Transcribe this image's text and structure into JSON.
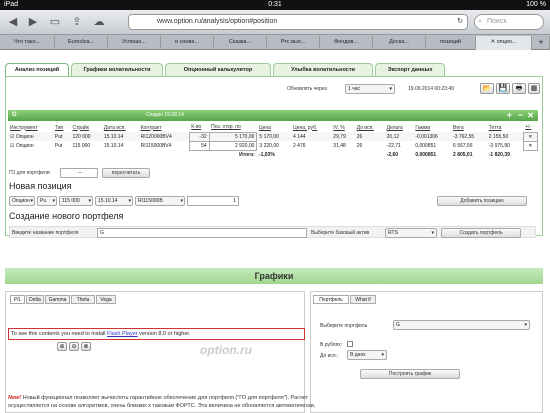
{
  "status": {
    "carrier": "iPad",
    "time": "0:31",
    "battery": "100 %"
  },
  "browser": {
    "url": "www.option.ru/analysis/option#position",
    "search_placeholder": "Поиск",
    "tabs": [
      "Что тако...",
      "Euroclea...",
      "Успешн...",
      "и снова...",
      "Сказка...",
      "Ртс вых...",
      "Фондов...",
      "Доска...",
      "позиций",
      "опцио..."
    ]
  },
  "app_tabs": [
    "Анализ позиций",
    "Графики волатильности",
    "Опционный калькулятор",
    "Улыбка волатильности",
    "Экспорт данных"
  ],
  "refresh": {
    "label": "Обновлять через",
    "value": "1 час",
    "timestamp": "19.09.2014 00:23:49"
  },
  "portfolio_header": {
    "name": "G",
    "created": "Создан 19.09.14"
  },
  "table": {
    "headers": [
      "Инструмент",
      "Тип",
      "Страйк",
      "Дата исп.",
      "Контракт",
      "К-во",
      "Поз. откр. по",
      "Цена",
      "Цена, руб.",
      "IV, %",
      "До исп.",
      "Дельта",
      "Гамма",
      "Вега",
      "Тетта",
      "+/-"
    ],
    "rows": [
      [
        "Опцион",
        "Put",
        "120 000",
        "15.10.14",
        "RI120000BV4",
        "-32",
        "5 170,00",
        "5 170,00",
        "4 144",
        "29,79",
        "26",
        "20,12",
        "-0,001306",
        "-3 762,55",
        "2 155,50"
      ],
      [
        "Опцион",
        "Put",
        "115 000",
        "15.10.14",
        "RI115000BV4",
        "54",
        "2 920,00",
        "3 220,00",
        "2 476",
        "31,48",
        "26",
        "-22,71",
        "0,000851",
        "6 567,56",
        "-3 975,90"
      ]
    ],
    "total_label": "Итого:",
    "total_pct": "-1,03%",
    "totals": [
      "-2,60",
      "0,000851",
      "2 805,01",
      "-1 820,39"
    ]
  },
  "go": {
    "label": "ГО для портфеля:",
    "value": "--",
    "button": "пересчитать"
  },
  "new_position": {
    "title": "Новая позиция",
    "type": "Опцион",
    "kind": "Pu",
    "strike": "115 000",
    "date": "15.10.14",
    "contract": "RI115000B",
    "qty": "1",
    "button": "Добавить позицию"
  },
  "new_portfolio": {
    "title": "Создание нового портфеля",
    "name_label": "Введите название портфеля",
    "name_value": "G",
    "asset_label": "Выберите базовый актив",
    "asset_value": "RTS",
    "button": "Создать портфель"
  },
  "charts": {
    "title": "Графики",
    "tabs": [
      "P/L",
      "Delta",
      "Gamma",
      "Theta",
      "Vega"
    ],
    "flash_msg": "To see this contents you need to install ",
    "flash_link": "Flash Player",
    "flash_msg2": " version 8.0 or higher.",
    "watermark": "option.ru"
  },
  "side": {
    "tabs": [
      "Портфель",
      "What if"
    ],
    "portfolio_label": "Выберите портфель",
    "portfolio_value": "G",
    "rub_label": "В рублях:",
    "until_label": "До исп.:",
    "until_value": "В днях",
    "button": "Построить график"
  },
  "footer": {
    "badge": "New!",
    "text1": "Новый функционал позволяет вычислять гарантийное обеспечение для портфеля (\"ГО для портфеля\"). Расчет",
    "text2": "осуществляется на основе алгоритмов, очень близких к таковым ФОРТС. Эта величина не обновляется автоматически,"
  }
}
